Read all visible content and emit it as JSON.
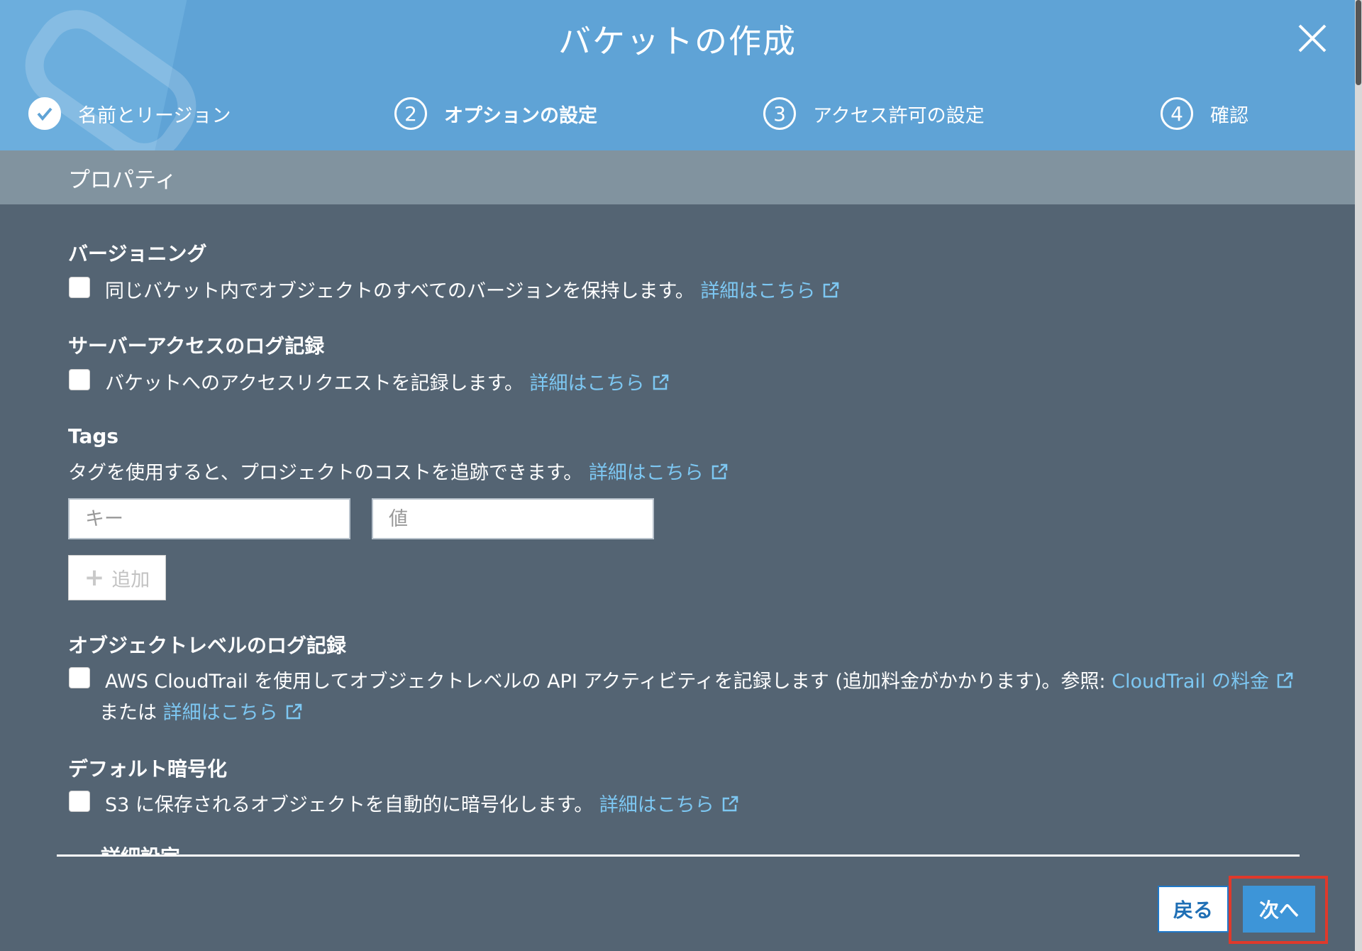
{
  "dialog": {
    "title": "バケットの作成"
  },
  "steps": [
    {
      "number": "1",
      "label": "名前とリージョン",
      "state": "done"
    },
    {
      "number": "2",
      "label": "オプションの設定",
      "state": "active"
    },
    {
      "number": "3",
      "label": "アクセス許可の設定",
      "state": "pending"
    },
    {
      "number": "4",
      "label": "確認",
      "state": "pending"
    }
  ],
  "properties": {
    "heading": "プロパティ"
  },
  "versioning": {
    "title": "バージョニング",
    "description": "同じバケット内でオブジェクトのすべてのバージョンを保持します。",
    "link": "詳細はこちら",
    "checked": false
  },
  "server_access_logging": {
    "title": "サーバーアクセスのログ記録",
    "description": "バケットへのアクセスリクエストを記録します。",
    "link": "詳細はこちら",
    "checked": false
  },
  "tags": {
    "title": "Tags",
    "description": "タグを使用すると、プロジェクトのコストを追跡できます。",
    "link": "詳細はこちら",
    "key_placeholder": "キー",
    "value_placeholder": "値",
    "add_label": "追加"
  },
  "object_level_logging": {
    "title": "オブジェクトレベルのログ記録",
    "description": "AWS CloudTrail を使用してオブジェクトレベルの API アクティビティを記録します (追加料金がかかります)。参照:",
    "pricing_link": "CloudTrail の料金",
    "or_text": "または",
    "link": "詳細はこちら",
    "checked": false
  },
  "default_encryption": {
    "title": "デフォルト暗号化",
    "description": "S3 に保存されるオブジェクトを自動的に暗号化します。",
    "link": "詳細はこちら",
    "checked": false
  },
  "advanced": {
    "title": "詳細設定"
  },
  "footer": {
    "back_label": "戻る",
    "next_label": "次へ"
  },
  "colors": {
    "header_bg": "#5fa3d6",
    "body_bg": "#546473",
    "link": "#7dc7f2",
    "primary_button": "#3d95d8",
    "highlight": "#e0392b"
  }
}
